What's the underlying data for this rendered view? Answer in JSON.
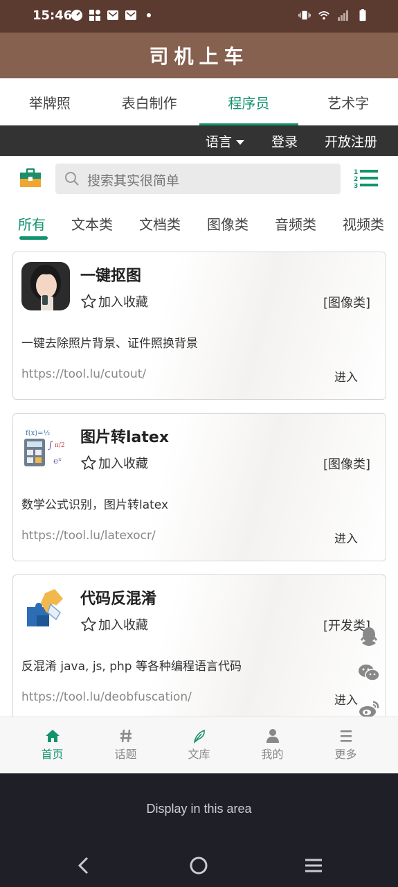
{
  "status_bar": {
    "time": "15:46",
    "icons": [
      "speed-icon",
      "grid-icon",
      "mail-icon",
      "mail-icon",
      "dot-icon",
      "vibrate-icon",
      "wifi-icon",
      "signal-icon",
      "battery-icon"
    ]
  },
  "header": {
    "title": "司机上车"
  },
  "top_tabs": [
    {
      "label": "举牌照",
      "active": false
    },
    {
      "label": "表白制作",
      "active": false
    },
    {
      "label": "程序员",
      "active": true
    },
    {
      "label": "艺术字",
      "active": false
    }
  ],
  "dark_nav": {
    "language": "语言",
    "login": "登录",
    "register": "开放注册"
  },
  "search": {
    "placeholder": "搜索其实很简单"
  },
  "filter_tabs": [
    "所有",
    "文本类",
    "文档类",
    "图像类",
    "音频类",
    "视频类"
  ],
  "filter_active": "所有",
  "cards": [
    {
      "title": "一键抠图",
      "favorite_label": "加入收藏",
      "category": "[图像类]",
      "description": "一键去除照片背景、证件照换背景",
      "url": "https://tool.lu/cutout/",
      "enter_label": "进入"
    },
    {
      "title": "图片转latex",
      "favorite_label": "加入收藏",
      "category": "[图像类]",
      "description": "数学公式识别，图片转latex",
      "url": "https://tool.lu/latexocr/",
      "enter_label": "进入"
    },
    {
      "title": "代码反混淆",
      "favorite_label": "加入收藏",
      "category": "[开发类]",
      "description": "反混淆 java, js, php 等各种编程语言代码",
      "url": "https://tool.lu/deobfuscation/",
      "enter_label": "进入"
    }
  ],
  "bottom_tabs": [
    {
      "label": "首页",
      "icon": "home-icon",
      "active": true
    },
    {
      "label": "话题",
      "icon": "hashtag-icon",
      "active": false
    },
    {
      "label": "文库",
      "icon": "feather-icon",
      "active": false
    },
    {
      "label": "我的",
      "icon": "user-icon",
      "active": false
    },
    {
      "label": "更多",
      "icon": "menu-icon",
      "active": false
    }
  ],
  "display_area": {
    "text": "Display in this area"
  },
  "colors": {
    "accent": "#12936e",
    "header": "#86614f",
    "status_bar": "#5b3a30",
    "dark_nav": "#333333"
  }
}
